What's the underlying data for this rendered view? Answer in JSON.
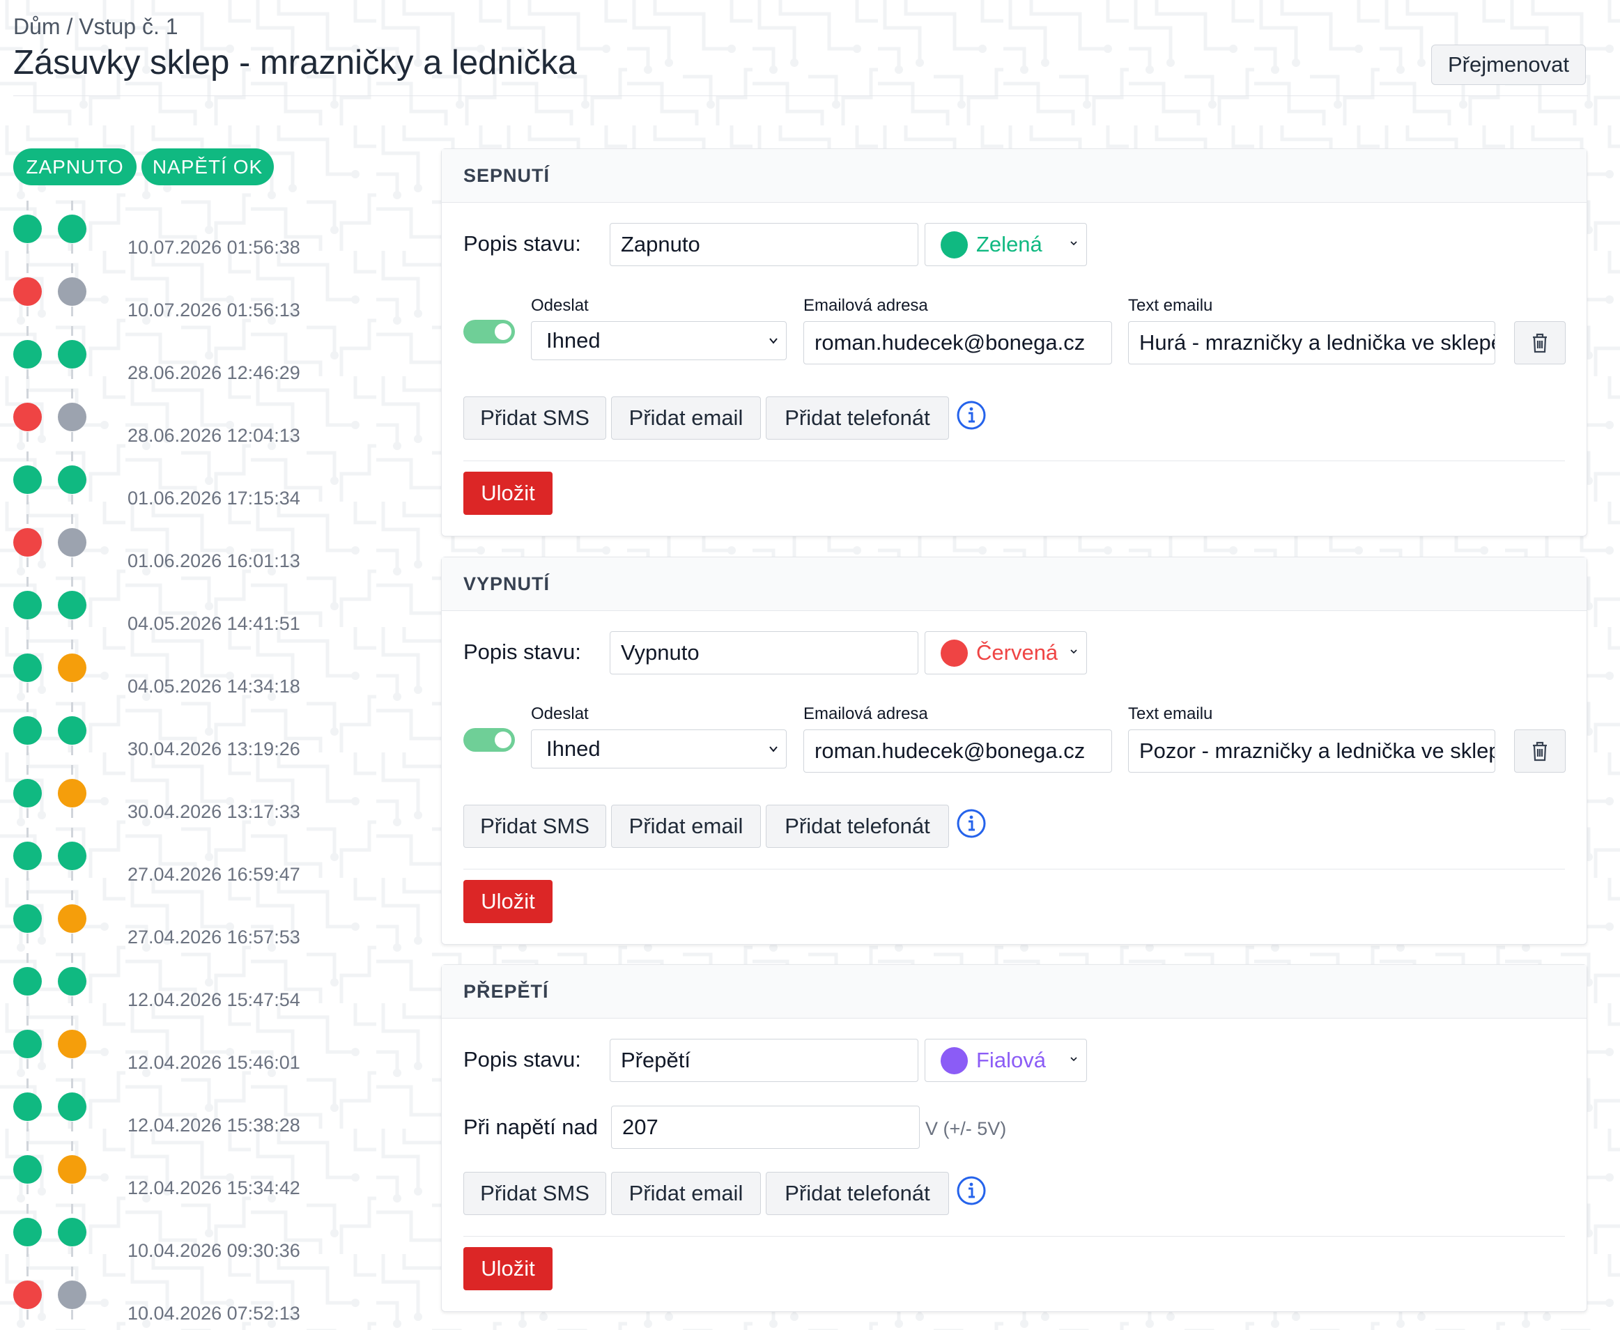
{
  "breadcrumb": "Dům / Vstup č. 1",
  "title": "Zásuvky sklep - mrazničky a lednička",
  "rename_label": "Přejmenovat",
  "badges": [
    "ZAPNUTO",
    "NAPĚTÍ OK"
  ],
  "colors": {
    "green": "#10b981",
    "red": "#ef4444",
    "gray": "#9ca3af",
    "orange": "#f59e0b",
    "purple": "#8b5cf6",
    "save": "#dc2626",
    "info": "#2563eb"
  },
  "history": [
    {
      "time": "10.07.2026 01:56:38",
      "state": "green",
      "voltage": "green"
    },
    {
      "time": "10.07.2026 01:56:13",
      "state": "red",
      "voltage": "gray"
    },
    {
      "time": "28.06.2026 12:46:29",
      "state": "green",
      "voltage": "green"
    },
    {
      "time": "28.06.2026 12:04:13",
      "state": "red",
      "voltage": "gray"
    },
    {
      "time": "01.06.2026 17:15:34",
      "state": "green",
      "voltage": "green"
    },
    {
      "time": "01.06.2026 16:01:13",
      "state": "red",
      "voltage": "gray"
    },
    {
      "time": "04.05.2026 14:41:51",
      "state": "green",
      "voltage": "green"
    },
    {
      "time": "04.05.2026 14:34:18",
      "state": "green",
      "voltage": "orange"
    },
    {
      "time": "30.04.2026 13:19:26",
      "state": "green",
      "voltage": "green"
    },
    {
      "time": "30.04.2026 13:17:33",
      "state": "green",
      "voltage": "orange"
    },
    {
      "time": "27.04.2026 16:59:47",
      "state": "green",
      "voltage": "green"
    },
    {
      "time": "27.04.2026 16:57:53",
      "state": "green",
      "voltage": "orange"
    },
    {
      "time": "12.04.2026 15:47:54",
      "state": "green",
      "voltage": "green"
    },
    {
      "time": "12.04.2026 15:46:01",
      "state": "green",
      "voltage": "orange"
    },
    {
      "time": "12.04.2026 15:38:28",
      "state": "green",
      "voltage": "green"
    },
    {
      "time": "12.04.2026 15:34:42",
      "state": "green",
      "voltage": "orange"
    },
    {
      "time": "10.04.2026 09:30:36",
      "state": "green",
      "voltage": "green"
    },
    {
      "time": "10.04.2026 07:52:13",
      "state": "red",
      "voltage": "gray"
    }
  ],
  "cards": [
    {
      "header": "SEPNUTÍ",
      "state_label": "Popis stavu:",
      "state_value": "Zapnuto",
      "color_name": "Zelená",
      "color_key": "green",
      "send_label": "Odeslat",
      "send_value": "Ihned",
      "email_label": "Emailová adresa",
      "email_value": "roman.hudecek@bonega.cz",
      "text_label": "Text emailu",
      "text_value": "Hurá - mrazničky a lednička ve sklepě",
      "add_sms": "Přidat SMS",
      "add_email": "Přidat email",
      "add_call": "Přidat telefonát",
      "save_label": "Uložit"
    },
    {
      "header": "VYPNUTÍ",
      "state_label": "Popis stavu:",
      "state_value": "Vypnuto",
      "color_name": "Červená",
      "color_key": "red",
      "send_label": "Odeslat",
      "send_value": "Ihned",
      "email_label": "Emailová adresa",
      "email_value": "roman.hudecek@bonega.cz",
      "text_label": "Text emailu",
      "text_value": "Pozor - mrazničky a lednička ve sklepě",
      "add_sms": "Přidat SMS",
      "add_email": "Přidat email",
      "add_call": "Přidat telefonát",
      "save_label": "Uložit"
    },
    {
      "header": "PŘEPĚTÍ",
      "state_label": "Popis stavu:",
      "state_value": "Přepětí",
      "color_name": "Fialová",
      "color_key": "purple",
      "voltage_label": "Při napětí nad",
      "voltage_value": "207",
      "voltage_unit": "V (+/- 5V)",
      "add_sms": "Přidat SMS",
      "add_email": "Přidat email",
      "add_call": "Přidat telefonát",
      "save_label": "Uložit"
    }
  ]
}
